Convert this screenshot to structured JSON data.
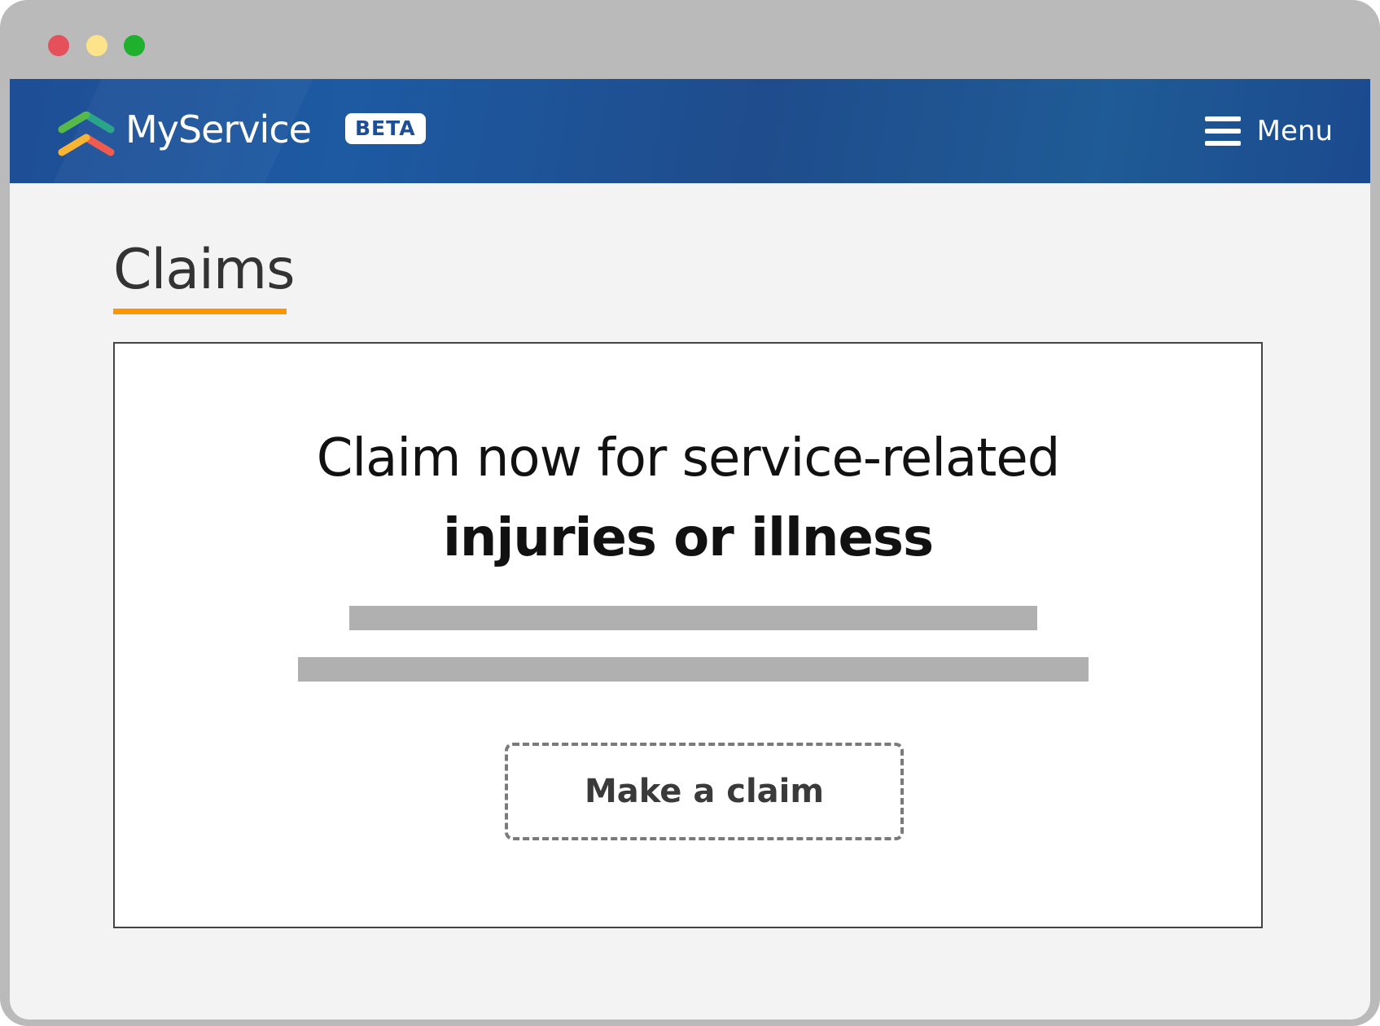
{
  "window": {
    "traffic_lights": [
      {
        "name": "close",
        "color": "#e5505a"
      },
      {
        "name": "minimize",
        "color": "#fde389"
      },
      {
        "name": "maximize",
        "color": "#1fb02e"
      }
    ]
  },
  "header": {
    "brand": "MyService",
    "badge": "BETA",
    "menu_label": "Menu",
    "menu_icon": "hamburger-icon",
    "logo_icon": "chevron-stack-logo"
  },
  "main": {
    "title": "Claims",
    "accent_color": "#ff9500",
    "card": {
      "headline_line1": "Claim now for service-related",
      "headline_line2": "injuries or illness",
      "button_label": "Make a claim"
    }
  },
  "colors": {
    "header_blue": "#1e4e95",
    "accent_orange": "#ff9500"
  }
}
